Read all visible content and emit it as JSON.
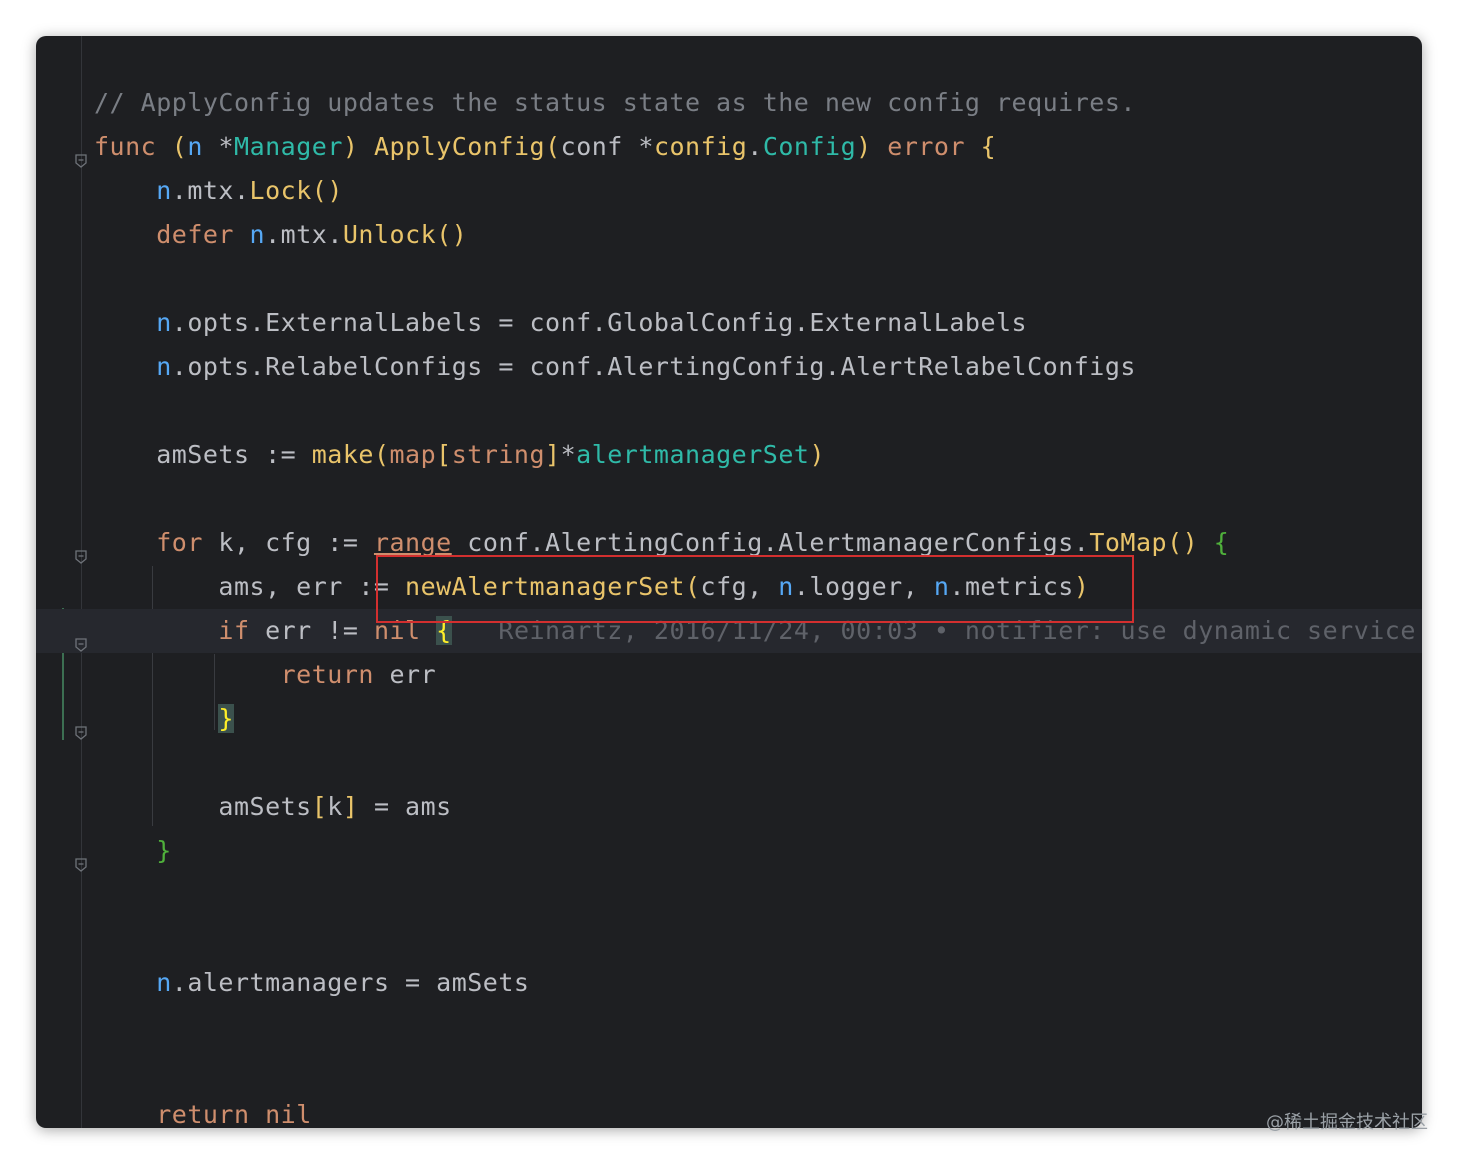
{
  "editor": {
    "lines": [
      {
        "segments": [
          {
            "t": "// ApplyConfig updates the status state as the new config requires.",
            "c": "cm"
          }
        ]
      },
      {
        "segments": [
          {
            "t": "func",
            "c": "kw"
          },
          {
            "t": " "
          },
          {
            "t": "(",
            "c": "br1"
          },
          {
            "t": "n",
            "c": "recv"
          },
          {
            "t": " *"
          },
          {
            "t": "Manager",
            "c": "typ"
          },
          {
            "t": ")",
            "c": "br1"
          },
          {
            "t": " "
          },
          {
            "t": "ApplyConfig",
            "c": "fn"
          },
          {
            "t": "(",
            "c": "br1"
          },
          {
            "t": "conf *"
          },
          {
            "t": "config",
            "c": "fn"
          },
          {
            "t": "."
          },
          {
            "t": "Config",
            "c": "typ"
          },
          {
            "t": ")",
            "c": "br1"
          },
          {
            "t": " "
          },
          {
            "t": "error",
            "c": "kw"
          },
          {
            "t": " "
          },
          {
            "t": "{",
            "c": "br1"
          }
        ]
      },
      {
        "segments": [
          {
            "t": "    "
          },
          {
            "t": "n",
            "c": "recv"
          },
          {
            "t": ".mtx."
          },
          {
            "t": "Lock",
            "c": "mth"
          },
          {
            "t": "()",
            "c": "br1"
          }
        ]
      },
      {
        "segments": [
          {
            "t": "    "
          },
          {
            "t": "defer",
            "c": "kw"
          },
          {
            "t": " "
          },
          {
            "t": "n",
            "c": "recv"
          },
          {
            "t": ".mtx."
          },
          {
            "t": "Unlock",
            "c": "mth"
          },
          {
            "t": "()",
            "c": "br1"
          }
        ]
      },
      {
        "segments": []
      },
      {
        "segments": [
          {
            "t": "    "
          },
          {
            "t": "n",
            "c": "recv"
          },
          {
            "t": ".opts.ExternalLabels = conf.GlobalConfig.ExternalLabels"
          }
        ]
      },
      {
        "segments": [
          {
            "t": "    "
          },
          {
            "t": "n",
            "c": "recv"
          },
          {
            "t": ".opts.RelabelConfigs = conf.AlertingConfig.AlertRelabelConfigs"
          }
        ]
      },
      {
        "segments": []
      },
      {
        "segments": [
          {
            "t": "    amSets := "
          },
          {
            "t": "make",
            "c": "fn"
          },
          {
            "t": "(",
            "c": "br1"
          },
          {
            "t": "map",
            "c": "kw"
          },
          {
            "t": "[",
            "c": "br1"
          },
          {
            "t": "string",
            "c": "kw"
          },
          {
            "t": "]",
            "c": "br1"
          },
          {
            "t": "*"
          },
          {
            "t": "alertmanagerSet",
            "c": "typ"
          },
          {
            "t": ")",
            "c": "br1"
          }
        ]
      },
      {
        "segments": []
      },
      {
        "segments": [
          {
            "t": "    "
          },
          {
            "t": "for",
            "c": "kw"
          },
          {
            "t": " k, cfg := "
          },
          {
            "t": "range",
            "c": "kw range-u"
          },
          {
            "t": " conf.AlertingConfig.AlertmanagerConfigs."
          },
          {
            "t": "ToMap",
            "c": "mth"
          },
          {
            "t": "()",
            "c": "br1"
          },
          {
            "t": " "
          },
          {
            "t": "{",
            "c": "green"
          }
        ]
      },
      {
        "segments": [
          {
            "t": "        ams, err := "
          },
          {
            "t": "newAlertmanagerSet",
            "c": "fn"
          },
          {
            "t": "(",
            "c": "br1"
          },
          {
            "t": "cfg, "
          },
          {
            "t": "n",
            "c": "recv"
          },
          {
            "t": ".logger, "
          },
          {
            "t": "n",
            "c": "recv"
          },
          {
            "t": ".metrics"
          },
          {
            "t": ")",
            "c": "br1"
          }
        ]
      },
      {
        "segments": [
          {
            "t": "        "
          },
          {
            "t": "if",
            "c": "kw"
          },
          {
            "t": " err != "
          },
          {
            "t": "nil",
            "c": "kw"
          },
          {
            "t": " "
          },
          {
            "t": "{",
            "c": "hlbrace"
          },
          {
            "t": "   Reinartz, 2016/11/24, 00:03 • notifier: use dynamic service",
            "c": "blame"
          }
        ]
      },
      {
        "segments": [
          {
            "t": "            "
          },
          {
            "t": "return",
            "c": "kw"
          },
          {
            "t": " err"
          }
        ]
      },
      {
        "segments": [
          {
            "t": "        "
          },
          {
            "t": "}",
            "c": "hlbrace"
          }
        ]
      },
      {
        "segments": []
      },
      {
        "segments": [
          {
            "t": "        amSets"
          },
          {
            "t": "[",
            "c": "br1"
          },
          {
            "t": "k"
          },
          {
            "t": "]",
            "c": "br1"
          },
          {
            "t": " = ams"
          }
        ]
      },
      {
        "segments": [
          {
            "t": "    "
          },
          {
            "t": "}",
            "c": "green"
          }
        ]
      },
      {
        "segments": []
      },
      {
        "segments": []
      },
      {
        "segments": [
          {
            "t": "    "
          },
          {
            "t": "n",
            "c": "recv"
          },
          {
            "t": ".alertmanagers = amSets"
          }
        ]
      },
      {
        "segments": []
      },
      {
        "segments": []
      },
      {
        "segments": [
          {
            "t": "    "
          },
          {
            "t": "return",
            "c": "kw"
          },
          {
            "t": " "
          },
          {
            "t": "nil",
            "c": "kw"
          }
        ]
      },
      {
        "segments": [
          {
            "t": "}",
            "c": "br1"
          }
        ]
      }
    ],
    "fold_markers": [
      1,
      10,
      12,
      14,
      17,
      24
    ],
    "current_line": 12,
    "highlight_box_label": "newAlertmanagerSet call"
  },
  "watermark": "@稀土掘金技术社区"
}
